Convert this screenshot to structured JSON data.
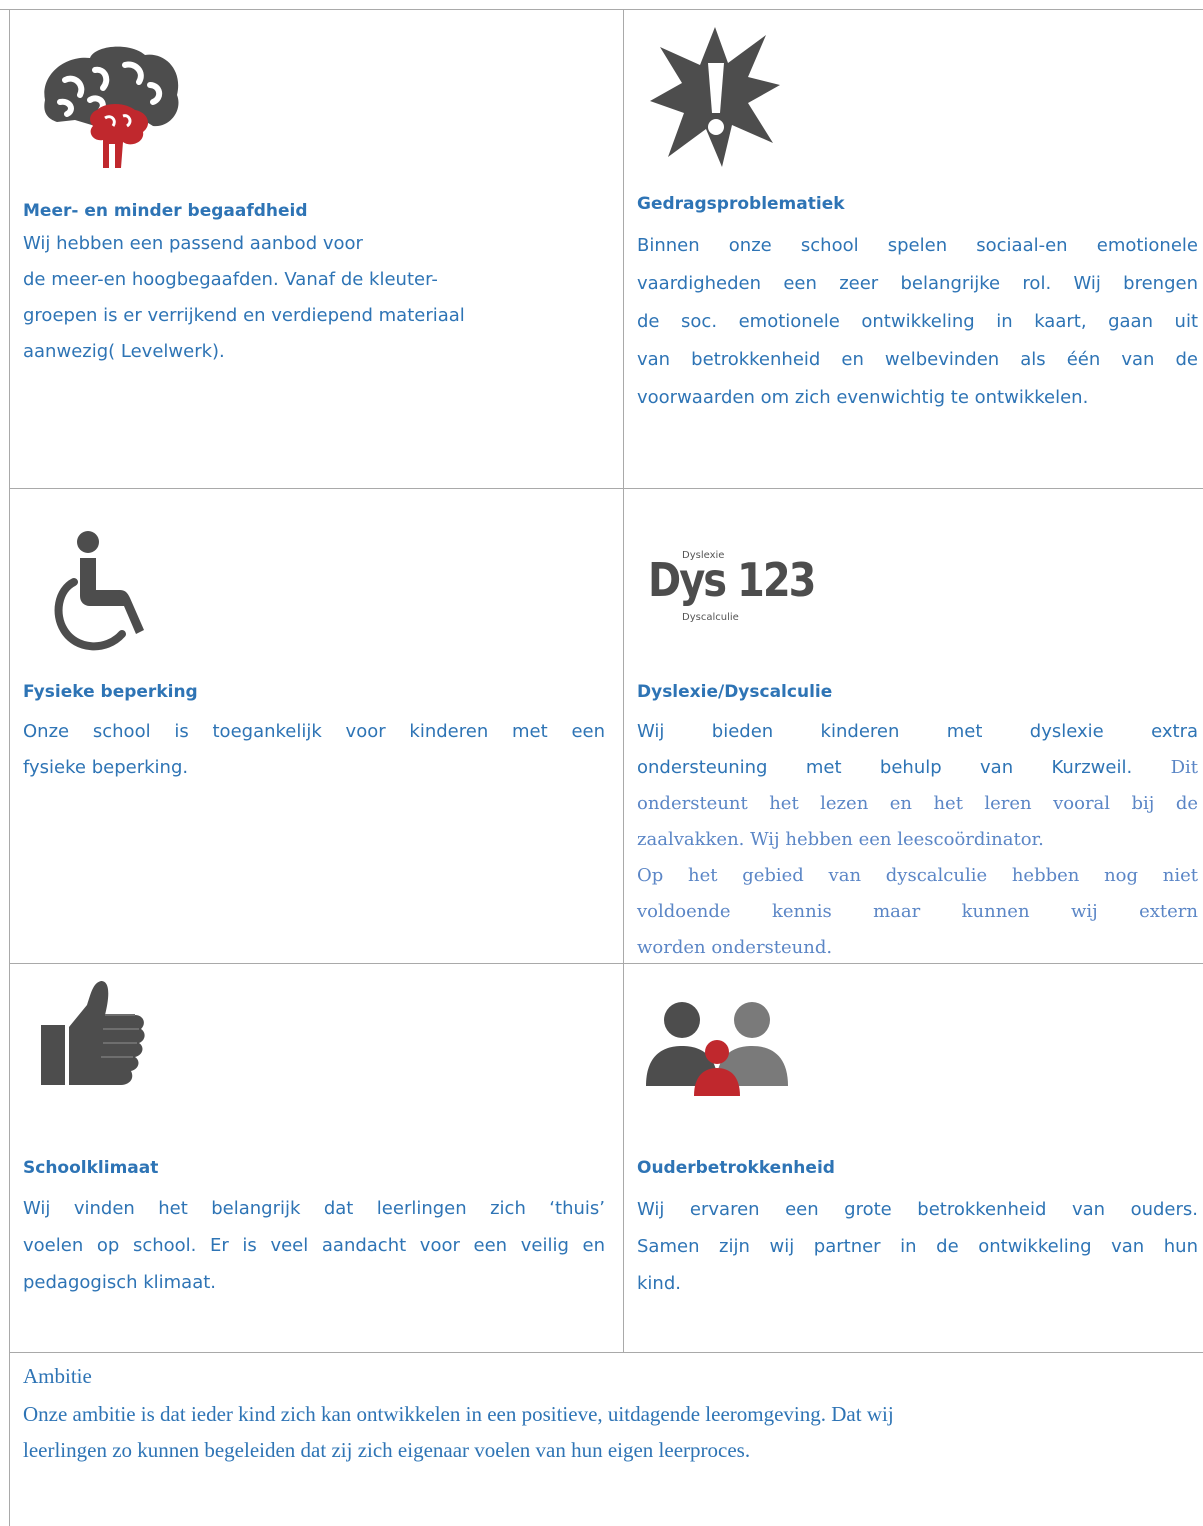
{
  "cells": {
    "begaafdheid": {
      "icon": "brain-icon",
      "title": "Meer- en minder begaafdheid",
      "lines": [
        "Wij hebben een passend aanbod voor",
        "de meer-en hoogbegaafden. Vanaf de kleuter-",
        "groepen is er verrijkend en verdiepend materiaal",
        "aanwezig( Levelwerk)."
      ]
    },
    "gedrag": {
      "icon": "exclamation-burst-icon",
      "title": "Gedragsproblematiek",
      "lines": [
        "Binnen onze school spelen sociaal-en emotionele",
        "vaardigheden een zeer belangrijke rol. Wij brengen",
        "de soc. emotionele ontwikkeling in kaart, gaan uit",
        "van betrokkenheid en welbevinden als één van de",
        "voorwaarden om zich evenwichtig te ontwikkelen."
      ]
    },
    "fysiek": {
      "icon": "wheelchair-icon",
      "title": "Fysieke beperking",
      "lines": [
        "Onze school is toegankelijk voor kinderen met een",
        "fysieke beperking."
      ]
    },
    "dyslexie": {
      "icon": "dys123-logo-icon",
      "logo_top": "Dyslexie",
      "logo_main": "Dys 123",
      "logo_bottom": "Dyscalculie",
      "title": "Dyslexie/Dyscalculie",
      "lines_sans": [
        "Wij bieden kinderen met dyslexie extra",
        "ondersteuning met behulp van Kurzweil."
      ],
      "line2_serif_tail": "Dit",
      "lines_serif": [
        "ondersteunt het lezen en het leren vooral bij de",
        "zaalvakken. Wij hebben een leescoördinator.",
        "Op het gebied van dyscalculie hebben nog niet",
        "voldoende kennis maar kunnen wij extern",
        "worden ondersteund."
      ]
    },
    "klimaat": {
      "icon": "thumbs-up-icon",
      "title": "Schoolklimaat",
      "lines": [
        "Wij vinden het belangrijk dat leerlingen zich ‘thuis’",
        "voelen op school. Er is veel aandacht voor een veilig en",
        "pedagogisch klimaat."
      ]
    },
    "ouders": {
      "icon": "people-icon",
      "title": "Ouderbetrokkenheid",
      "lines": [
        "Wij ervaren een grote betrokkenheid van ouders.",
        "Samen zijn wij partner in de ontwikkeling van hun",
        "kind."
      ]
    }
  },
  "ambitie": {
    "title": "Ambitie",
    "lines": [
      "Onze ambitie is dat ieder kind zich kan ontwikkelen in een positieve, uitdagende leeromgeving. Dat wij",
      "leerlingen zo kunnen begeleiden dat zij zich eigenaar voelen van hun eigen leerproces."
    ]
  },
  "colors": {
    "text_blue": "#2e74b5",
    "serif_blue": "#5b86c6",
    "icon_gray": "#4d4d4d",
    "icon_red": "#c0282d",
    "grid": "#a9a9a9"
  }
}
